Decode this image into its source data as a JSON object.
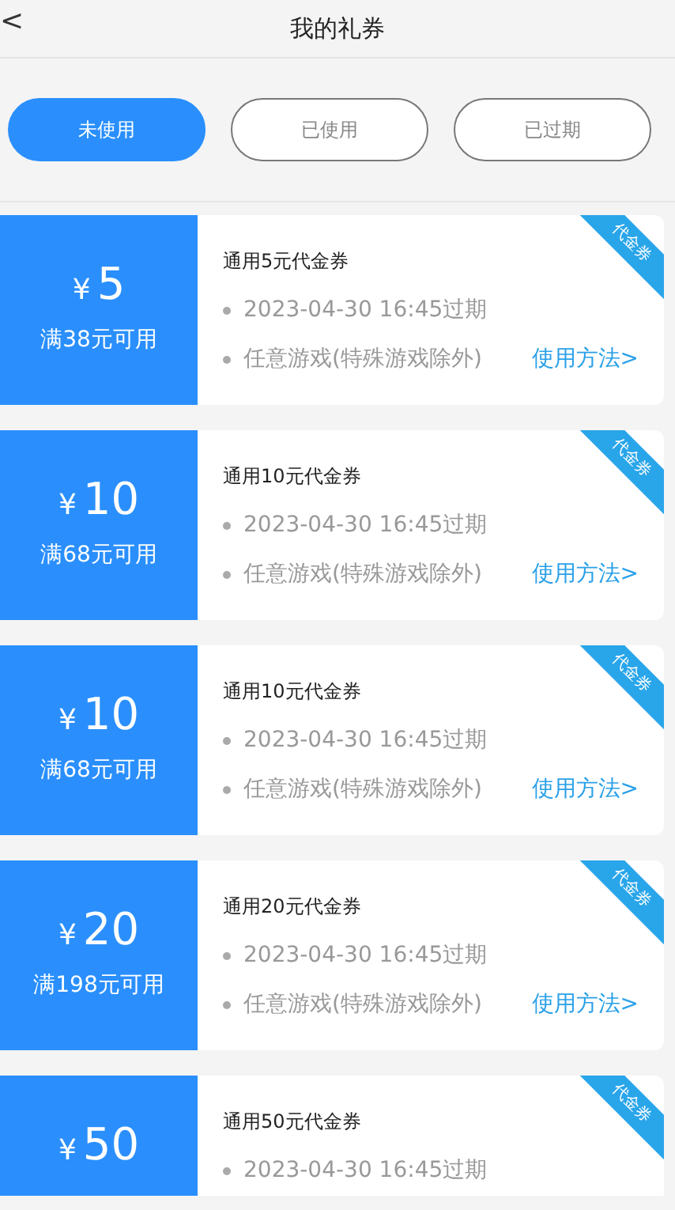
{
  "header": {
    "back": "<",
    "title": "我的礼券"
  },
  "tabs": [
    {
      "label": "未使用",
      "selected": true
    },
    {
      "label": "已使用",
      "selected": false
    },
    {
      "label": "已过期",
      "selected": false
    }
  ],
  "coupons": [
    {
      "amount": "5",
      "currency": "¥",
      "condition": "满38元可用",
      "name": "通用5元代金券",
      "expiry": "2023-04-30 16:45过期",
      "scope": "任意游戏(特殊游戏除外)",
      "link": "使用方法>",
      "ribbon": "代金券"
    },
    {
      "amount": "10",
      "currency": "¥",
      "condition": "满68元可用",
      "name": "通用10元代金券",
      "expiry": "2023-04-30 16:45过期",
      "scope": "任意游戏(特殊游戏除外)",
      "link": "使用方法>",
      "ribbon": "代金券"
    },
    {
      "amount": "10",
      "currency": "¥",
      "condition": "满68元可用",
      "name": "通用10元代金券",
      "expiry": "2023-04-30 16:45过期",
      "scope": "任意游戏(特殊游戏除外)",
      "link": "使用方法>",
      "ribbon": "代金券"
    },
    {
      "amount": "20",
      "currency": "¥",
      "condition": "满198元可用",
      "name": "通用20元代金券",
      "expiry": "2023-04-30 16:45过期",
      "scope": "任意游戏(特殊游戏除外)",
      "link": "使用方法>",
      "ribbon": "代金券"
    },
    {
      "amount": "50",
      "currency": "¥",
      "name": "通用50元代金券",
      "expiry": "2023-04-30 16:45过期",
      "ribbon": "代金券"
    }
  ]
}
